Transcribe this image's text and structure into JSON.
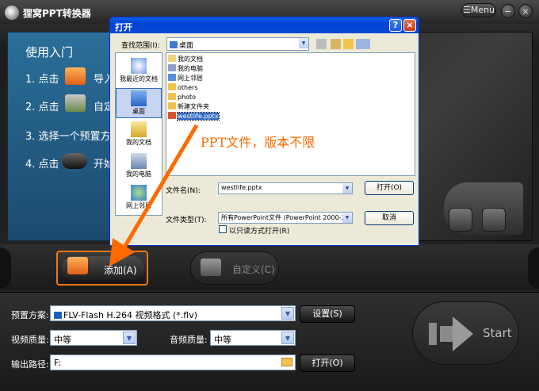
{
  "app": {
    "title": "狸窝PPT转换器",
    "menu_label": "Menu",
    "minimize_glyph": "−",
    "close_glyph": "×"
  },
  "guide": {
    "title": "使用入门",
    "steps": [
      {
        "num": "1. 点击",
        "text": "导入"
      },
      {
        "num": "2. 点击",
        "text": "自定"
      },
      {
        "num": "3. 选择一个预置方",
        "text": ""
      },
      {
        "num": "4. 点击",
        "text": "开始"
      }
    ]
  },
  "toolbar": {
    "add_label": "添加(A)",
    "custom_label": "自定义(C)"
  },
  "settings": {
    "preset_label": "预置方案:",
    "preset_value": "FLV-Flash H.264 视频格式 (*.flv)",
    "settings_button": "设置(S)",
    "video_quality_label": "视频质量:",
    "video_quality_value": "中等",
    "audio_quality_label": "音频质量:",
    "audio_quality_value": "中等",
    "output_label": "输出路径:",
    "output_value": "F:",
    "open_button": "打开(O)",
    "start_label": "Start"
  },
  "dialog": {
    "title": "打开",
    "help_glyph": "?",
    "close_glyph": "×",
    "look_in_label": "查找范围(I):",
    "look_in_value": "桌面",
    "places": [
      {
        "label": "我最近的文档"
      },
      {
        "label": "桌面"
      },
      {
        "label": "我的文档"
      },
      {
        "label": "我的电脑"
      },
      {
        "label": "网上邻居"
      }
    ],
    "files": [
      {
        "name": "我的文档",
        "icon": "folder-docs"
      },
      {
        "name": "我的电脑",
        "icon": "computer"
      },
      {
        "name": "网上邻居",
        "icon": "network"
      },
      {
        "name": "others",
        "icon": "folder"
      },
      {
        "name": "photo",
        "icon": "folder"
      },
      {
        "name": "新建文件夹",
        "icon": "folder"
      },
      {
        "name": "westlife.pptx",
        "icon": "pptx"
      }
    ],
    "annotation": "PPT文件，版本不限",
    "filename_label": "文件名(N):",
    "filename_value": "westlife.pptx",
    "filetype_label": "文件类型(T):",
    "filetype_value": "所有PowerPoint文件 (PowerPoint 2000-20",
    "readonly_label": "以只读方式打开(R)",
    "open_button": "打开(O)",
    "cancel_button": "取消"
  },
  "colors": {
    "accent_orange": "#f2780f",
    "xp_blue": "#0a5ee6",
    "guide_blue": "#2a6f9a"
  }
}
